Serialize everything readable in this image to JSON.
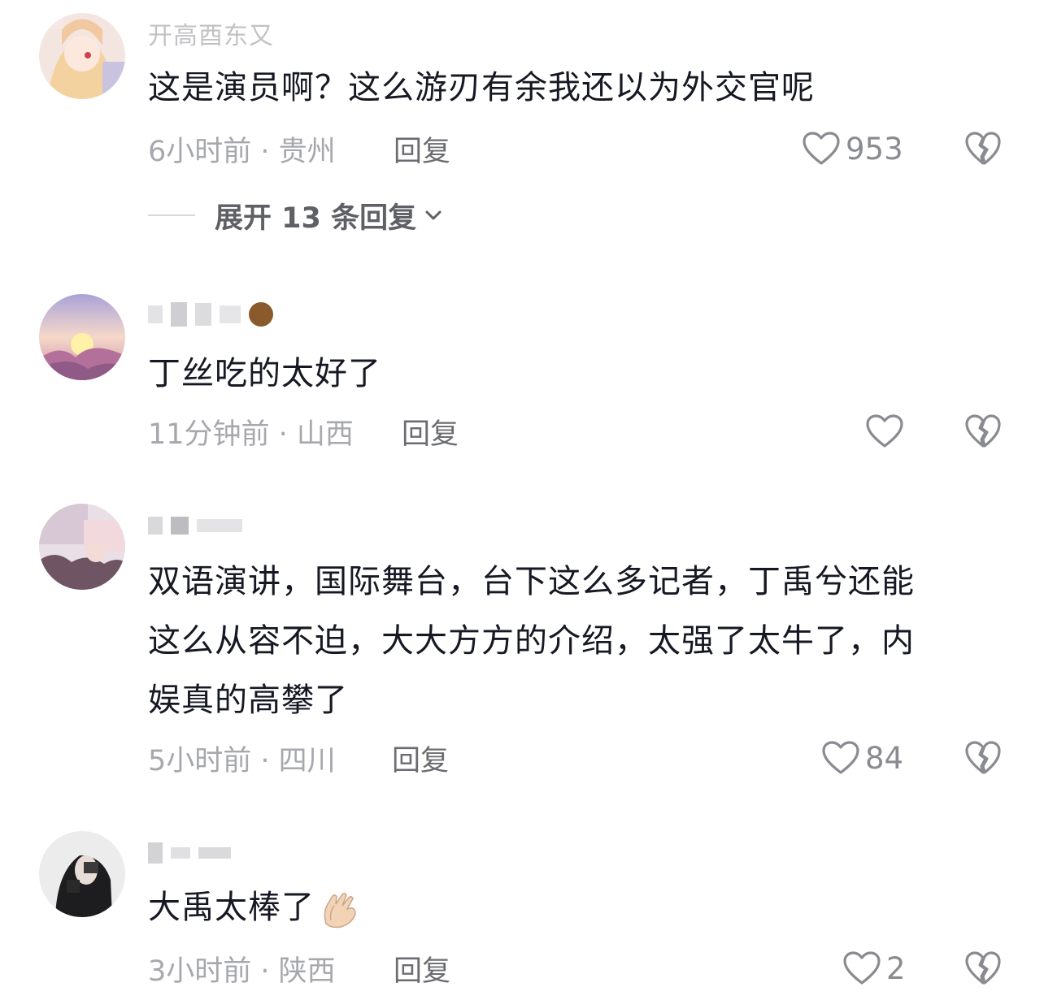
{
  "comments": [
    {
      "username": "开高酉东又",
      "text": "这是演员啊？这么游刃有余我还以为外交官呢",
      "time": "6小时前",
      "location": "贵州",
      "meta": "6小时前 · 贵州",
      "reply_label": "回复",
      "likes": "953",
      "expand_label": "展开 13 条回复"
    },
    {
      "username": "",
      "text": "丁丝吃的太好了",
      "time": "11分钟前",
      "location": "山西",
      "meta": "11分钟前 · 山西",
      "reply_label": "回复",
      "likes": ""
    },
    {
      "username": "",
      "text_lines": [
        "双语演讲，国际舞台，台下这么多记者，丁禹兮还能",
        "这么从容不迫，大大方方的介绍，太强了太牛了，内",
        "娱真的高攀了"
      ],
      "time": "5小时前",
      "location": "四川",
      "meta": "5小时前 · 四川",
      "reply_label": "回复",
      "likes": "84"
    },
    {
      "username": "",
      "text": "大禹太棒了",
      "time": "3小时前",
      "location": "陕西",
      "meta": "3小时前 · 陕西",
      "reply_label": "回复",
      "likes": "2"
    }
  ],
  "icons": {
    "like": "heart-outline-icon",
    "dislike": "broken-heart-icon",
    "expand": "chevron-down-icon",
    "emoji": "clapping-hands-emoji"
  },
  "colors": {
    "text_primary": "#161823",
    "text_secondary": "#a7a8ad",
    "reply": "#6b6c71"
  }
}
